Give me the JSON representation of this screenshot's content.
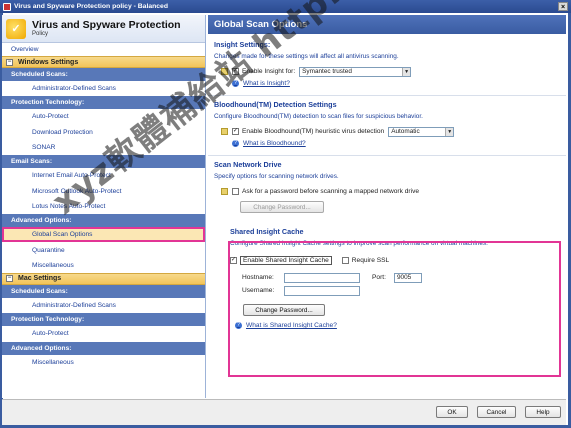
{
  "window": {
    "title": "Virus and Spyware Protection policy - Balanced",
    "close_glyph": "×"
  },
  "brand": {
    "title": "Virus and Spyware Protection",
    "subtitle": "Policy"
  },
  "nav": {
    "overview": "Overview",
    "windows": {
      "label": "Windows Settings",
      "toggle": "−",
      "groups": [
        {
          "label": "Scheduled Scans:",
          "items": [
            "Administrator-Defined Scans"
          ]
        },
        {
          "label": "Protection Technology:",
          "items": [
            "Auto-Protect",
            "Download Protection",
            "SONAR"
          ]
        },
        {
          "label": "Email Scans:",
          "items": [
            "Internet Email Auto-Protect",
            "Microsoft Outlook Auto-Protect",
            "Lotus Notes Auto-Protect"
          ]
        },
        {
          "label": "Advanced Options:",
          "items": [
            "Global Scan Options",
            "Quarantine",
            "Miscellaneous"
          ]
        }
      ],
      "selected": "Global Scan Options"
    },
    "mac": {
      "label": "Mac Settings",
      "toggle": "−",
      "groups": [
        {
          "label": "Scheduled Scans:",
          "items": [
            "Administrator-Defined Scans"
          ]
        },
        {
          "label": "Protection Technology:",
          "items": [
            "Auto-Protect"
          ]
        },
        {
          "label": "Advanced Options:",
          "items": [
            "Miscellaneous"
          ]
        }
      ]
    }
  },
  "main": {
    "title": "Global Scan Options",
    "insight": {
      "heading": "Insight Settings:",
      "desc": "Changes made for these settings will affect all antivirus scanning.",
      "enable_label": "Enable Insight for:",
      "checked_glyph": "✓",
      "select_value": "Symantec trusted",
      "help": "What is Insight?"
    },
    "bloodhound": {
      "heading": "Bloodhound(TM) Detection Settings",
      "desc": "Configure Bloodhound(TM) detection to scan files for suspicious behavior.",
      "enable_label": "Enable Bloodhound(TM) heuristic virus detection",
      "checked_glyph": "✓",
      "select_value": "Automatic",
      "help": "What is Bloodhound?"
    },
    "network": {
      "heading": "Scan Network Drive",
      "desc": "Specify options for scanning network drives.",
      "ask_label": "Ask for a password before scanning a mapped network drive",
      "change_password": "Change Password..."
    },
    "shared": {
      "heading": "Shared Insight Cache",
      "desc": "Configure Shared Insight Cache settings to improve scan performance on virtual machines.",
      "enable_label": "Enable Shared Insight Cache",
      "checked_glyph": "✓",
      "ssl_label": "Require SSL",
      "hostname_label": "Hostname:",
      "username_label": "Username:",
      "port_label": "Port:",
      "port_value": "9005",
      "change_password": "Change Password...",
      "help": "What is Shared Insight Cache?"
    }
  },
  "footer": {
    "ok": "OK",
    "cancel": "Cancel",
    "help": "Help"
  },
  "watermark": "xyz軟體補給站 http://31.to",
  "colors": {
    "accent": "#3a5ca0",
    "highlight": "#e23595",
    "section": "#f2c45a",
    "link": "#1c3f99"
  }
}
